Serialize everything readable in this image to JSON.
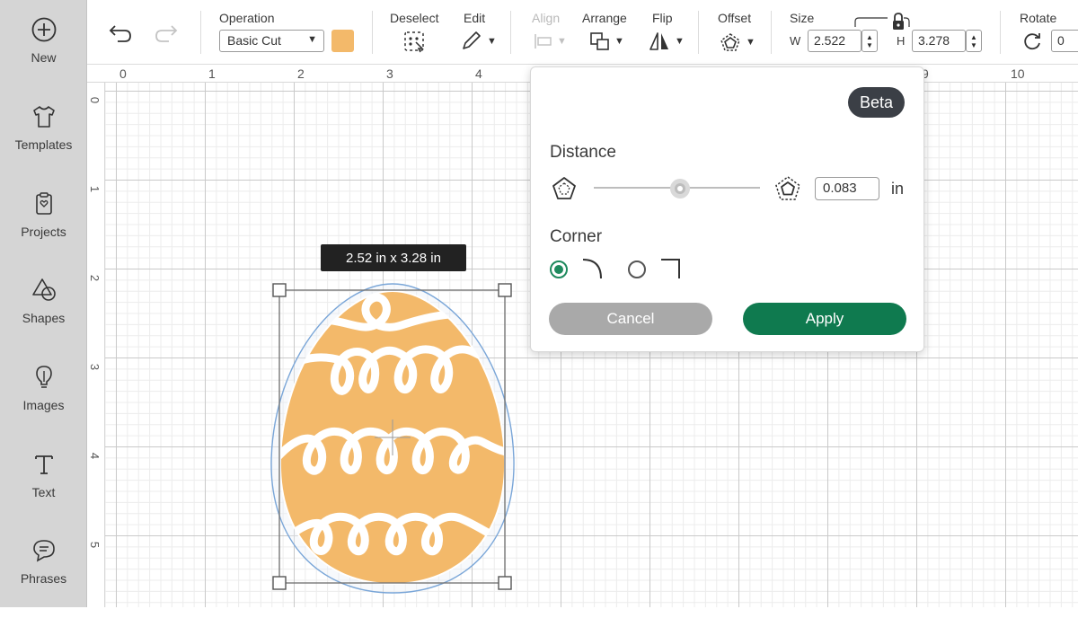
{
  "sidebar": {
    "items": [
      {
        "label": "New",
        "icon": "plus-circle-icon"
      },
      {
        "label": "Templates",
        "icon": "tshirt-icon"
      },
      {
        "label": "Projects",
        "icon": "projects-clipboard-icon"
      },
      {
        "label": "Shapes",
        "icon": "shapes-icon"
      },
      {
        "label": "Images",
        "icon": "lightbulb-icon"
      },
      {
        "label": "Text",
        "icon": "text-icon"
      },
      {
        "label": "Phrases",
        "icon": "chat-bubble-icon"
      }
    ]
  },
  "toolbar": {
    "operation_label": "Operation",
    "operation_value": "Basic Cut",
    "operation_color": "#f3b96a",
    "deselect_label": "Deselect",
    "edit_label": "Edit",
    "align_label": "Align",
    "arrange_label": "Arrange",
    "flip_label": "Flip",
    "offset_label": "Offset",
    "size_label": "Size",
    "width_prefix": "W",
    "width_value": "2.522",
    "height_prefix": "H",
    "height_value": "3.278",
    "rotate_label": "Rotate",
    "rotate_value": "0"
  },
  "canvas": {
    "ruler_top": [
      "0",
      "1",
      "2",
      "3",
      "4",
      "9",
      "10"
    ],
    "ruler_left": [
      "0",
      "1",
      "2",
      "3",
      "4",
      "5"
    ],
    "selection_tooltip": "2.52  in x 3.28  in",
    "shape_fill": "#f3b96a",
    "offset_outline_color": "#7aa6d8"
  },
  "offset_panel": {
    "badge": "Beta",
    "distance_label": "Distance",
    "distance_value": 0.083,
    "distance_text": "0.083",
    "distance_unit": "in",
    "corner_label": "Corner",
    "corner_options": [
      "rounded",
      "square"
    ],
    "corner_selected": "rounded",
    "cancel_label": "Cancel",
    "apply_label": "Apply",
    "accent_color": "#0f7a4f"
  }
}
